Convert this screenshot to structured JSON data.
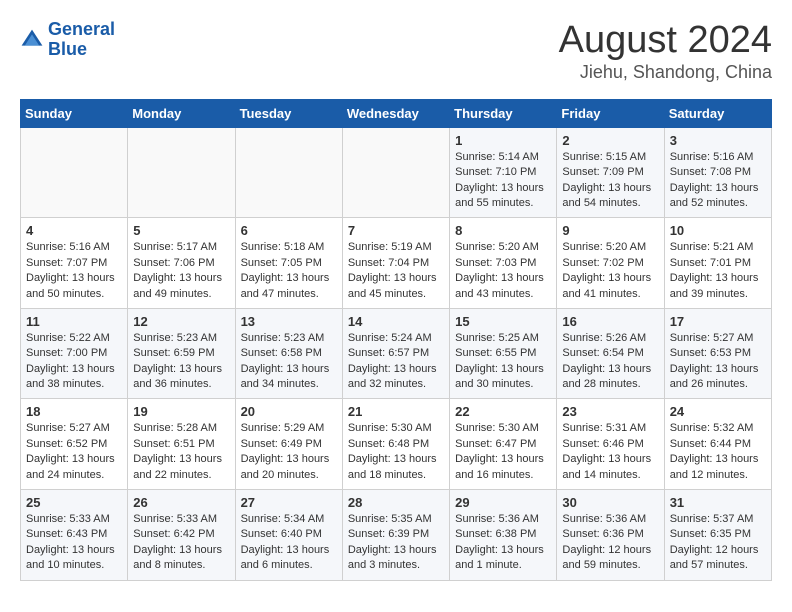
{
  "logo": {
    "line1": "General",
    "line2": "Blue"
  },
  "title": "August 2024",
  "subtitle": "Jiehu, Shandong, China",
  "days_of_week": [
    "Sunday",
    "Monday",
    "Tuesday",
    "Wednesday",
    "Thursday",
    "Friday",
    "Saturday"
  ],
  "weeks": [
    [
      {
        "day": "",
        "info": ""
      },
      {
        "day": "",
        "info": ""
      },
      {
        "day": "",
        "info": ""
      },
      {
        "day": "",
        "info": ""
      },
      {
        "day": "1",
        "info": "Sunrise: 5:14 AM\nSunset: 7:10 PM\nDaylight: 13 hours\nand 55 minutes."
      },
      {
        "day": "2",
        "info": "Sunrise: 5:15 AM\nSunset: 7:09 PM\nDaylight: 13 hours\nand 54 minutes."
      },
      {
        "day": "3",
        "info": "Sunrise: 5:16 AM\nSunset: 7:08 PM\nDaylight: 13 hours\nand 52 minutes."
      }
    ],
    [
      {
        "day": "4",
        "info": "Sunrise: 5:16 AM\nSunset: 7:07 PM\nDaylight: 13 hours\nand 50 minutes."
      },
      {
        "day": "5",
        "info": "Sunrise: 5:17 AM\nSunset: 7:06 PM\nDaylight: 13 hours\nand 49 minutes."
      },
      {
        "day": "6",
        "info": "Sunrise: 5:18 AM\nSunset: 7:05 PM\nDaylight: 13 hours\nand 47 minutes."
      },
      {
        "day": "7",
        "info": "Sunrise: 5:19 AM\nSunset: 7:04 PM\nDaylight: 13 hours\nand 45 minutes."
      },
      {
        "day": "8",
        "info": "Sunrise: 5:20 AM\nSunset: 7:03 PM\nDaylight: 13 hours\nand 43 minutes."
      },
      {
        "day": "9",
        "info": "Sunrise: 5:20 AM\nSunset: 7:02 PM\nDaylight: 13 hours\nand 41 minutes."
      },
      {
        "day": "10",
        "info": "Sunrise: 5:21 AM\nSunset: 7:01 PM\nDaylight: 13 hours\nand 39 minutes."
      }
    ],
    [
      {
        "day": "11",
        "info": "Sunrise: 5:22 AM\nSunset: 7:00 PM\nDaylight: 13 hours\nand 38 minutes."
      },
      {
        "day": "12",
        "info": "Sunrise: 5:23 AM\nSunset: 6:59 PM\nDaylight: 13 hours\nand 36 minutes."
      },
      {
        "day": "13",
        "info": "Sunrise: 5:23 AM\nSunset: 6:58 PM\nDaylight: 13 hours\nand 34 minutes."
      },
      {
        "day": "14",
        "info": "Sunrise: 5:24 AM\nSunset: 6:57 PM\nDaylight: 13 hours\nand 32 minutes."
      },
      {
        "day": "15",
        "info": "Sunrise: 5:25 AM\nSunset: 6:55 PM\nDaylight: 13 hours\nand 30 minutes."
      },
      {
        "day": "16",
        "info": "Sunrise: 5:26 AM\nSunset: 6:54 PM\nDaylight: 13 hours\nand 28 minutes."
      },
      {
        "day": "17",
        "info": "Sunrise: 5:27 AM\nSunset: 6:53 PM\nDaylight: 13 hours\nand 26 minutes."
      }
    ],
    [
      {
        "day": "18",
        "info": "Sunrise: 5:27 AM\nSunset: 6:52 PM\nDaylight: 13 hours\nand 24 minutes."
      },
      {
        "day": "19",
        "info": "Sunrise: 5:28 AM\nSunset: 6:51 PM\nDaylight: 13 hours\nand 22 minutes."
      },
      {
        "day": "20",
        "info": "Sunrise: 5:29 AM\nSunset: 6:49 PM\nDaylight: 13 hours\nand 20 minutes."
      },
      {
        "day": "21",
        "info": "Sunrise: 5:30 AM\nSunset: 6:48 PM\nDaylight: 13 hours\nand 18 minutes."
      },
      {
        "day": "22",
        "info": "Sunrise: 5:30 AM\nSunset: 6:47 PM\nDaylight: 13 hours\nand 16 minutes."
      },
      {
        "day": "23",
        "info": "Sunrise: 5:31 AM\nSunset: 6:46 PM\nDaylight: 13 hours\nand 14 minutes."
      },
      {
        "day": "24",
        "info": "Sunrise: 5:32 AM\nSunset: 6:44 PM\nDaylight: 13 hours\nand 12 minutes."
      }
    ],
    [
      {
        "day": "25",
        "info": "Sunrise: 5:33 AM\nSunset: 6:43 PM\nDaylight: 13 hours\nand 10 minutes."
      },
      {
        "day": "26",
        "info": "Sunrise: 5:33 AM\nSunset: 6:42 PM\nDaylight: 13 hours\nand 8 minutes."
      },
      {
        "day": "27",
        "info": "Sunrise: 5:34 AM\nSunset: 6:40 PM\nDaylight: 13 hours\nand 6 minutes."
      },
      {
        "day": "28",
        "info": "Sunrise: 5:35 AM\nSunset: 6:39 PM\nDaylight: 13 hours\nand 3 minutes."
      },
      {
        "day": "29",
        "info": "Sunrise: 5:36 AM\nSunset: 6:38 PM\nDaylight: 13 hours\nand 1 minute."
      },
      {
        "day": "30",
        "info": "Sunrise: 5:36 AM\nSunset: 6:36 PM\nDaylight: 12 hours\nand 59 minutes."
      },
      {
        "day": "31",
        "info": "Sunrise: 5:37 AM\nSunset: 6:35 PM\nDaylight: 12 hours\nand 57 minutes."
      }
    ]
  ]
}
